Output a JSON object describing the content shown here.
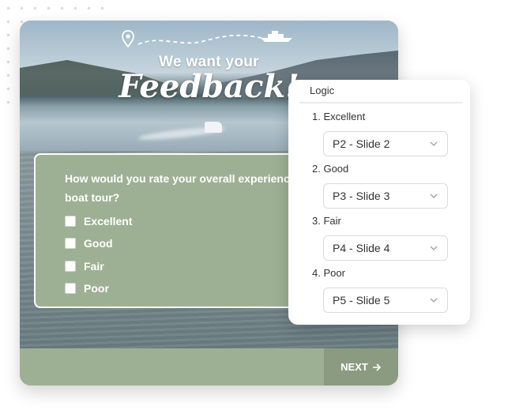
{
  "hero": {
    "line1": "We want your",
    "line2": "Feedback!"
  },
  "question": {
    "text": "How would you rate your overall experience boat tour?",
    "options": [
      {
        "label": "Excellent",
        "checked": false
      },
      {
        "label": "Good",
        "checked": false
      },
      {
        "label": "Fair",
        "checked": false
      },
      {
        "label": "Poor",
        "checked": false
      }
    ]
  },
  "footer": {
    "next_label": "NEXT",
    "next_icon": "arrow-right-icon"
  },
  "logic": {
    "title": "Logic",
    "rules": [
      {
        "label": "1. Excellent",
        "target": "P2 - Slide 2"
      },
      {
        "label": "2. Good",
        "target": "P3 - Slide 3"
      },
      {
        "label": "3. Fair",
        "target": "P4 - Slide 4"
      },
      {
        "label": "4. Poor",
        "target": "P5 - Slide 5"
      }
    ]
  },
  "colors": {
    "panel_green": "#9eb093",
    "button_green": "#8a9b81",
    "text_dark": "#333333"
  },
  "icons": [
    "location-pin-icon",
    "ship-icon",
    "chevron-down-icon",
    "arrow-right-icon"
  ]
}
